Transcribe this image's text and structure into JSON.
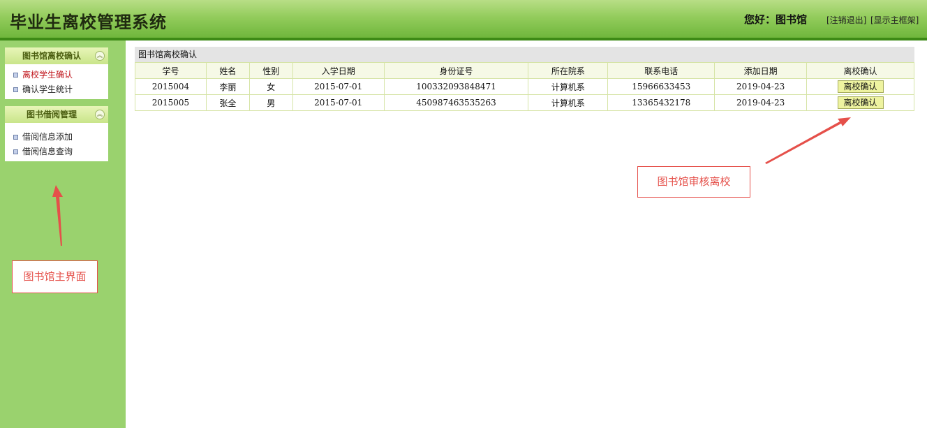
{
  "header": {
    "title": "毕业生离校管理系统",
    "greeting": "您好：图书馆",
    "logout_label": "[注销退出]",
    "show_frame_label": "[显示主框架]"
  },
  "sidebar": {
    "panels": [
      {
        "title": "图书馆离校确认",
        "items": [
          {
            "label": "离校学生确认",
            "active": true
          },
          {
            "label": "确认学生统计",
            "active": false
          }
        ]
      },
      {
        "title": "图书借阅管理",
        "items": [
          {
            "label": "借阅信息添加",
            "active": false
          },
          {
            "label": "借阅信息查询",
            "active": false
          }
        ]
      }
    ]
  },
  "main": {
    "section_title": "图书馆离校确认",
    "table": {
      "headers": [
        "学号",
        "姓名",
        "性别",
        "入学日期",
        "身份证号",
        "所在院系",
        "联系电话",
        "添加日期",
        "离校确认"
      ],
      "rows": [
        {
          "id": "2015004",
          "name": "李丽",
          "gender": "女",
          "enroll_date": "2015-07-01",
          "id_card": "100332093848471",
          "dept": "计算机系",
          "phone": "15966633453",
          "added": "2019-04-23",
          "action": "离校确认"
        },
        {
          "id": "2015005",
          "name": "张全",
          "gender": "男",
          "enroll_date": "2015-07-01",
          "id_card": "450987463535263",
          "dept": "计算机系",
          "phone": "13365432178",
          "added": "2019-04-23",
          "action": "离校确认"
        }
      ]
    }
  },
  "annotations": {
    "library_main": "图书馆主界面",
    "library_review": "图书馆审核离校"
  },
  "colors": {
    "header_green": "#93cc5c",
    "sidebar_green": "#9ad26e",
    "active_menu": "#c0151b",
    "annotation_red": "#e5504a"
  }
}
